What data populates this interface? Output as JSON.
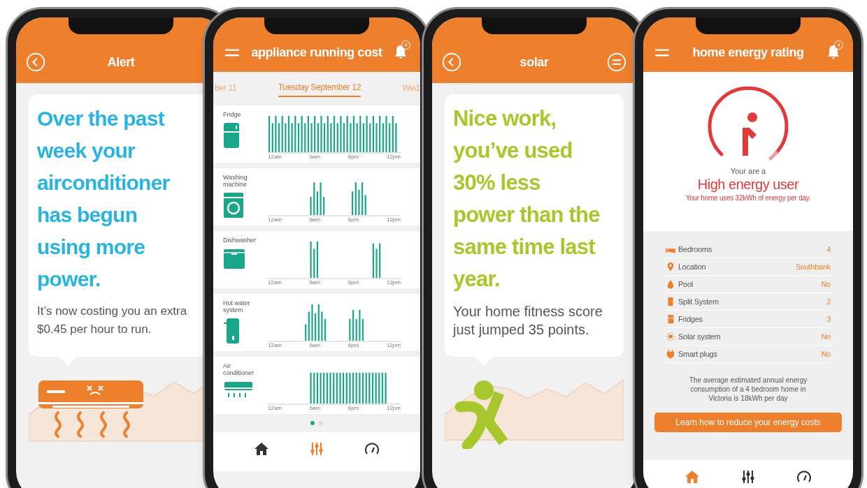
{
  "phones": [
    {
      "kind": "alert",
      "header": {
        "title": "Alert",
        "left": {
          "kind": "back"
        }
      },
      "headline": "Over the past week your airconditioner has begun using more power.",
      "body": "It’s now costing you an extra $0.45 per hour to run.",
      "illustration": {
        "kind": "aircon"
      }
    },
    {
      "kind": "appliances",
      "header": {
        "title": "appliance running cost",
        "left": {
          "kind": "menu"
        },
        "right": {
          "kind": "bell",
          "badge": "4"
        }
      },
      "dates": [
        {
          "label": "ber 11",
          "selected": false
        },
        {
          "label": "Tuesday September 12",
          "selected": true
        },
        {
          "label": "Wed",
          "selected": false
        }
      ],
      "appliances": [
        {
          "kind": "fridge",
          "name": "Fridge",
          "ticks": [
            "12am",
            "6am",
            "6pm",
            "12pm"
          ]
        },
        {
          "kind": "washer",
          "name": "Washing machine",
          "ticks": [
            "12am",
            "6am",
            "6pm",
            "12pm"
          ]
        },
        {
          "kind": "dishwasher",
          "name": "Dishwasher",
          "ticks": [
            "12am",
            "6am",
            "6pm",
            "12pm"
          ]
        },
        {
          "kind": "heater",
          "name": "Hot water system",
          "ticks": [
            "12am",
            "6am",
            "6pm",
            "12pm"
          ]
        },
        {
          "kind": "aircon",
          "name": "Air conditioner",
          "ticks": [
            "12am",
            "6am",
            "6pm",
            "12pm"
          ]
        }
      ],
      "pages": [
        {
          "selected": true
        },
        {
          "selected": false
        }
      ],
      "nav": [
        {
          "kind": "home",
          "selected": false
        },
        {
          "kind": "sliders",
          "selected": true
        },
        {
          "kind": "gauge",
          "selected": false
        }
      ]
    },
    {
      "kind": "alert",
      "header": {
        "title": "solar",
        "left": {
          "kind": "back"
        },
        "right": {
          "kind": "menu"
        }
      },
      "headline": "Nice work, you’ve used 30% less power than the same time last year.",
      "body": "Your home fitness score just jumped 35 points.",
      "illustration": {
        "kind": "runner"
      }
    },
    {
      "kind": "rating",
      "header": {
        "title": "home energy rating",
        "left": {
          "kind": "menu"
        },
        "right": {
          "kind": "bell",
          "badge": "4"
        }
      },
      "intro": "Your are a",
      "rating": "High energy user",
      "detail": "Your home uses 32kWh of energy per day.",
      "facts": [
        {
          "kind": "bed",
          "label": "Bedrooms",
          "value": "4"
        },
        {
          "kind": "pin",
          "label": "Location",
          "value": "Southbank"
        },
        {
          "kind": "drop",
          "label": "Pool",
          "value": "No"
        },
        {
          "kind": "split",
          "label": "Split System",
          "value": "2"
        },
        {
          "kind": "fridge",
          "label": "Fridges",
          "value": "3"
        },
        {
          "kind": "sun",
          "label": "Solar system",
          "value": "No"
        },
        {
          "kind": "plug",
          "label": "Smart plugs",
          "value": "No"
        }
      ],
      "note": "The average estimated annual energy consumption of a 4 bedroom home in Victoria is 18kWh per day",
      "button": "Learn how to reduce your energy costs",
      "nav": [
        {
          "kind": "home",
          "selected": true
        },
        {
          "kind": "sliders",
          "selected": false
        },
        {
          "kind": "gauge",
          "selected": false
        }
      ]
    }
  ]
}
